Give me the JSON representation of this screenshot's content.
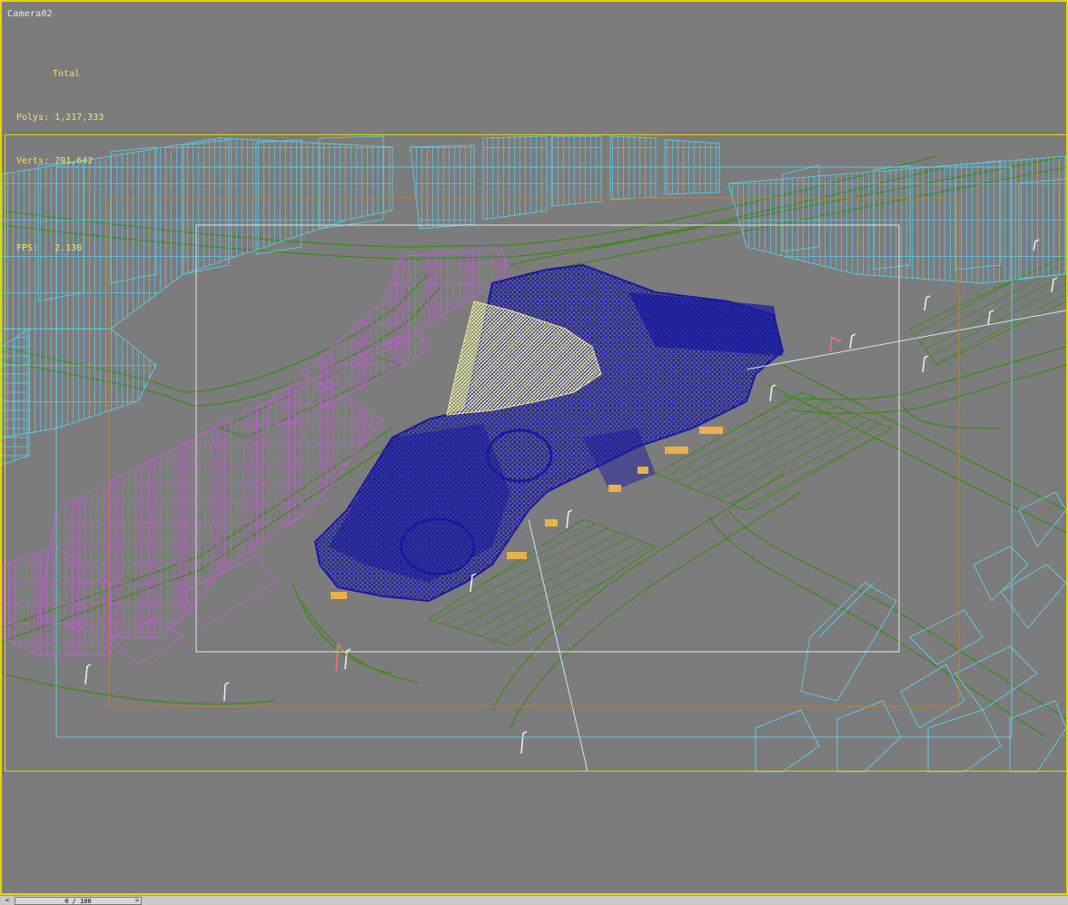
{
  "viewport": {
    "camera_label": "Camera02",
    "stats_header": "Total",
    "polys_label": "Polys:",
    "polys_value": "1,217,333",
    "verts_label": "Verts:",
    "verts_value": "791,642",
    "fps_label": "FPS:",
    "fps_value": "2.130"
  },
  "timeline": {
    "position_text": "0 / 100",
    "prev_arrow": "<",
    "next_arrow": ">"
  },
  "colors": {
    "background": "#7c7c7c",
    "frame_yellow": "#e8d300",
    "stats_text": "#f2e06a",
    "wire_cyan": "#5ec8e0",
    "wire_magenta": "#c35ad8",
    "wire_blue": "#1a1aa0",
    "wire_yellow": "#e6e69a",
    "road_green": "#3c8a18",
    "render_region_orange": "#c8801e",
    "render_region_white": "#e6e6e6"
  },
  "icons": [
    "street-lamp-icon"
  ]
}
